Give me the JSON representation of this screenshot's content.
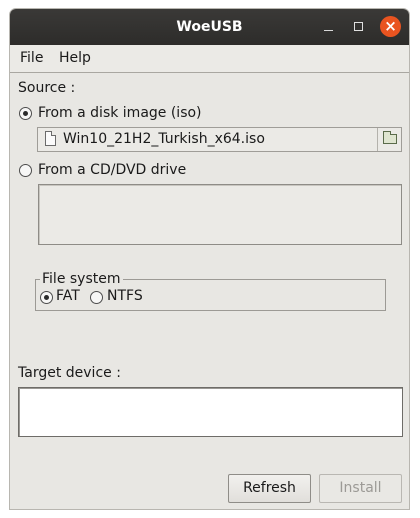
{
  "window": {
    "title": "WoeUSB",
    "close_glyph": "×"
  },
  "menu": {
    "file": "File",
    "help": "Help"
  },
  "source": {
    "label": "Source :",
    "disk_image_option": "From a disk image (iso)",
    "disk_image_selected": true,
    "iso_path": "Win10_21H2_Turkish_x64.iso",
    "cd_option": "From a CD/DVD drive",
    "cd_selected": false
  },
  "filesystem": {
    "legend": "File system",
    "fat_label": "FAT",
    "fat_selected": true,
    "ntfs_label": "NTFS",
    "ntfs_selected": false
  },
  "target": {
    "label": "Target device :"
  },
  "buttons": {
    "refresh": "Refresh",
    "install": "Install",
    "install_enabled": false
  },
  "icons": {
    "file": "file-icon",
    "folder": "folder-open-icon",
    "minimize": "minimize-icon",
    "maximize": "maximize-icon",
    "close": "close-icon"
  },
  "colors": {
    "close_button": "#e95420",
    "titlebar": "#2d2c2a",
    "window_bg": "#e8e7e3"
  }
}
